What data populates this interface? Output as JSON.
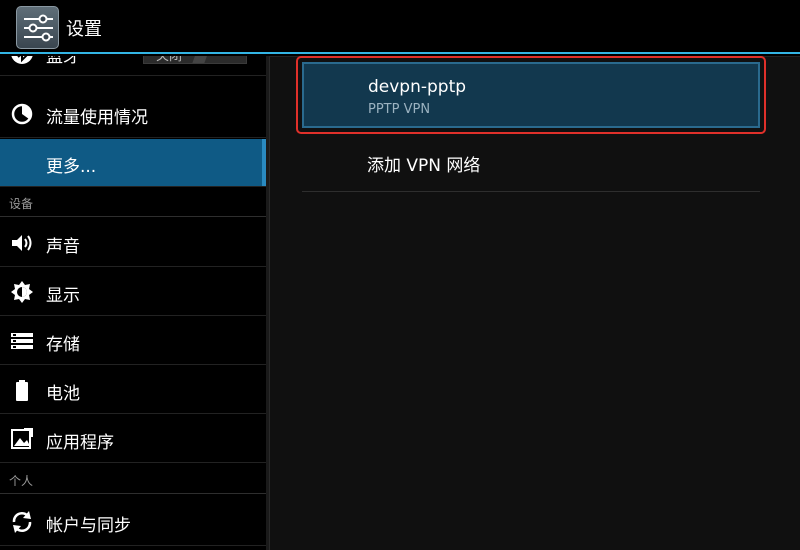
{
  "actionbar": {
    "title": "设置",
    "icon": "settings-sliders-icon"
  },
  "sidebar": {
    "bluetooth": {
      "label": "蓝牙",
      "icon": "bluetooth-icon",
      "toggle": "关闭"
    },
    "data_usage": {
      "label": "流量使用情况",
      "icon": "data-usage-icon"
    },
    "more": {
      "label": "更多...",
      "selected": true
    },
    "section_device": "设备",
    "sound": {
      "label": "声音",
      "icon": "speaker-icon"
    },
    "display": {
      "label": "显示",
      "icon": "brightness-icon"
    },
    "storage": {
      "label": "存储",
      "icon": "storage-icon"
    },
    "battery": {
      "label": "电池",
      "icon": "battery-icon"
    },
    "apps": {
      "label": "应用程序",
      "icon": "apps-icon"
    },
    "section_personal": "个人",
    "accounts": {
      "label": "帐户与同步",
      "icon": "sync-icon"
    }
  },
  "vpn": {
    "entries": [
      {
        "name": "devpn-pptp",
        "type": "PPTP VPN"
      }
    ],
    "add_label": "添加 VPN 网络"
  },
  "colors": {
    "accent": "#33b5e5",
    "selected": "#0f5a85",
    "highlight": "#e0302a"
  }
}
